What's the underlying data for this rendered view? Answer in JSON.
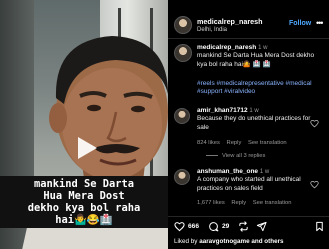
{
  "video": {
    "caption": "mankind Se Darta\nHua Mera Dost\ndekho kya bol raha\nhai🤷‍♂️😂🏥"
  },
  "header": {
    "username": "medicalrep_naresh",
    "location": "Delhi, India",
    "follow_label": "Follow",
    "more_label": "•••"
  },
  "post": {
    "username": "medicalrep_naresh",
    "age": "1 w",
    "text": "mankind Se Darta Hua Mera Dost dekho kya bol raha hai🤷 🏥 🏥",
    "hashtags": "#reels #medicalrepresentative #medical #support #viralvideo"
  },
  "comments": [
    {
      "username": "amir_khan71712",
      "age": "1 w",
      "text": "Because they do unethical practices for sale",
      "likes": "824 likes",
      "reply_label": "Reply",
      "translate_label": "See translation",
      "replies_label": "View all 3 replies"
    },
    {
      "username": "anshuman_the_one",
      "age": "1 w",
      "text": "A company who started all unethical practices on sales field",
      "likes": "1,677 likes",
      "reply_label": "Reply",
      "translate_label": "See translation"
    }
  ],
  "actions": {
    "like_count": "666",
    "comment_count": "29"
  },
  "liked_by": {
    "prefix": "Liked by",
    "user": "aaravgotnogame",
    "suffix": "and others"
  },
  "colors": {
    "accent": "#4fa8ff",
    "hashtag": "#8ab4ff",
    "background": "#000000"
  }
}
